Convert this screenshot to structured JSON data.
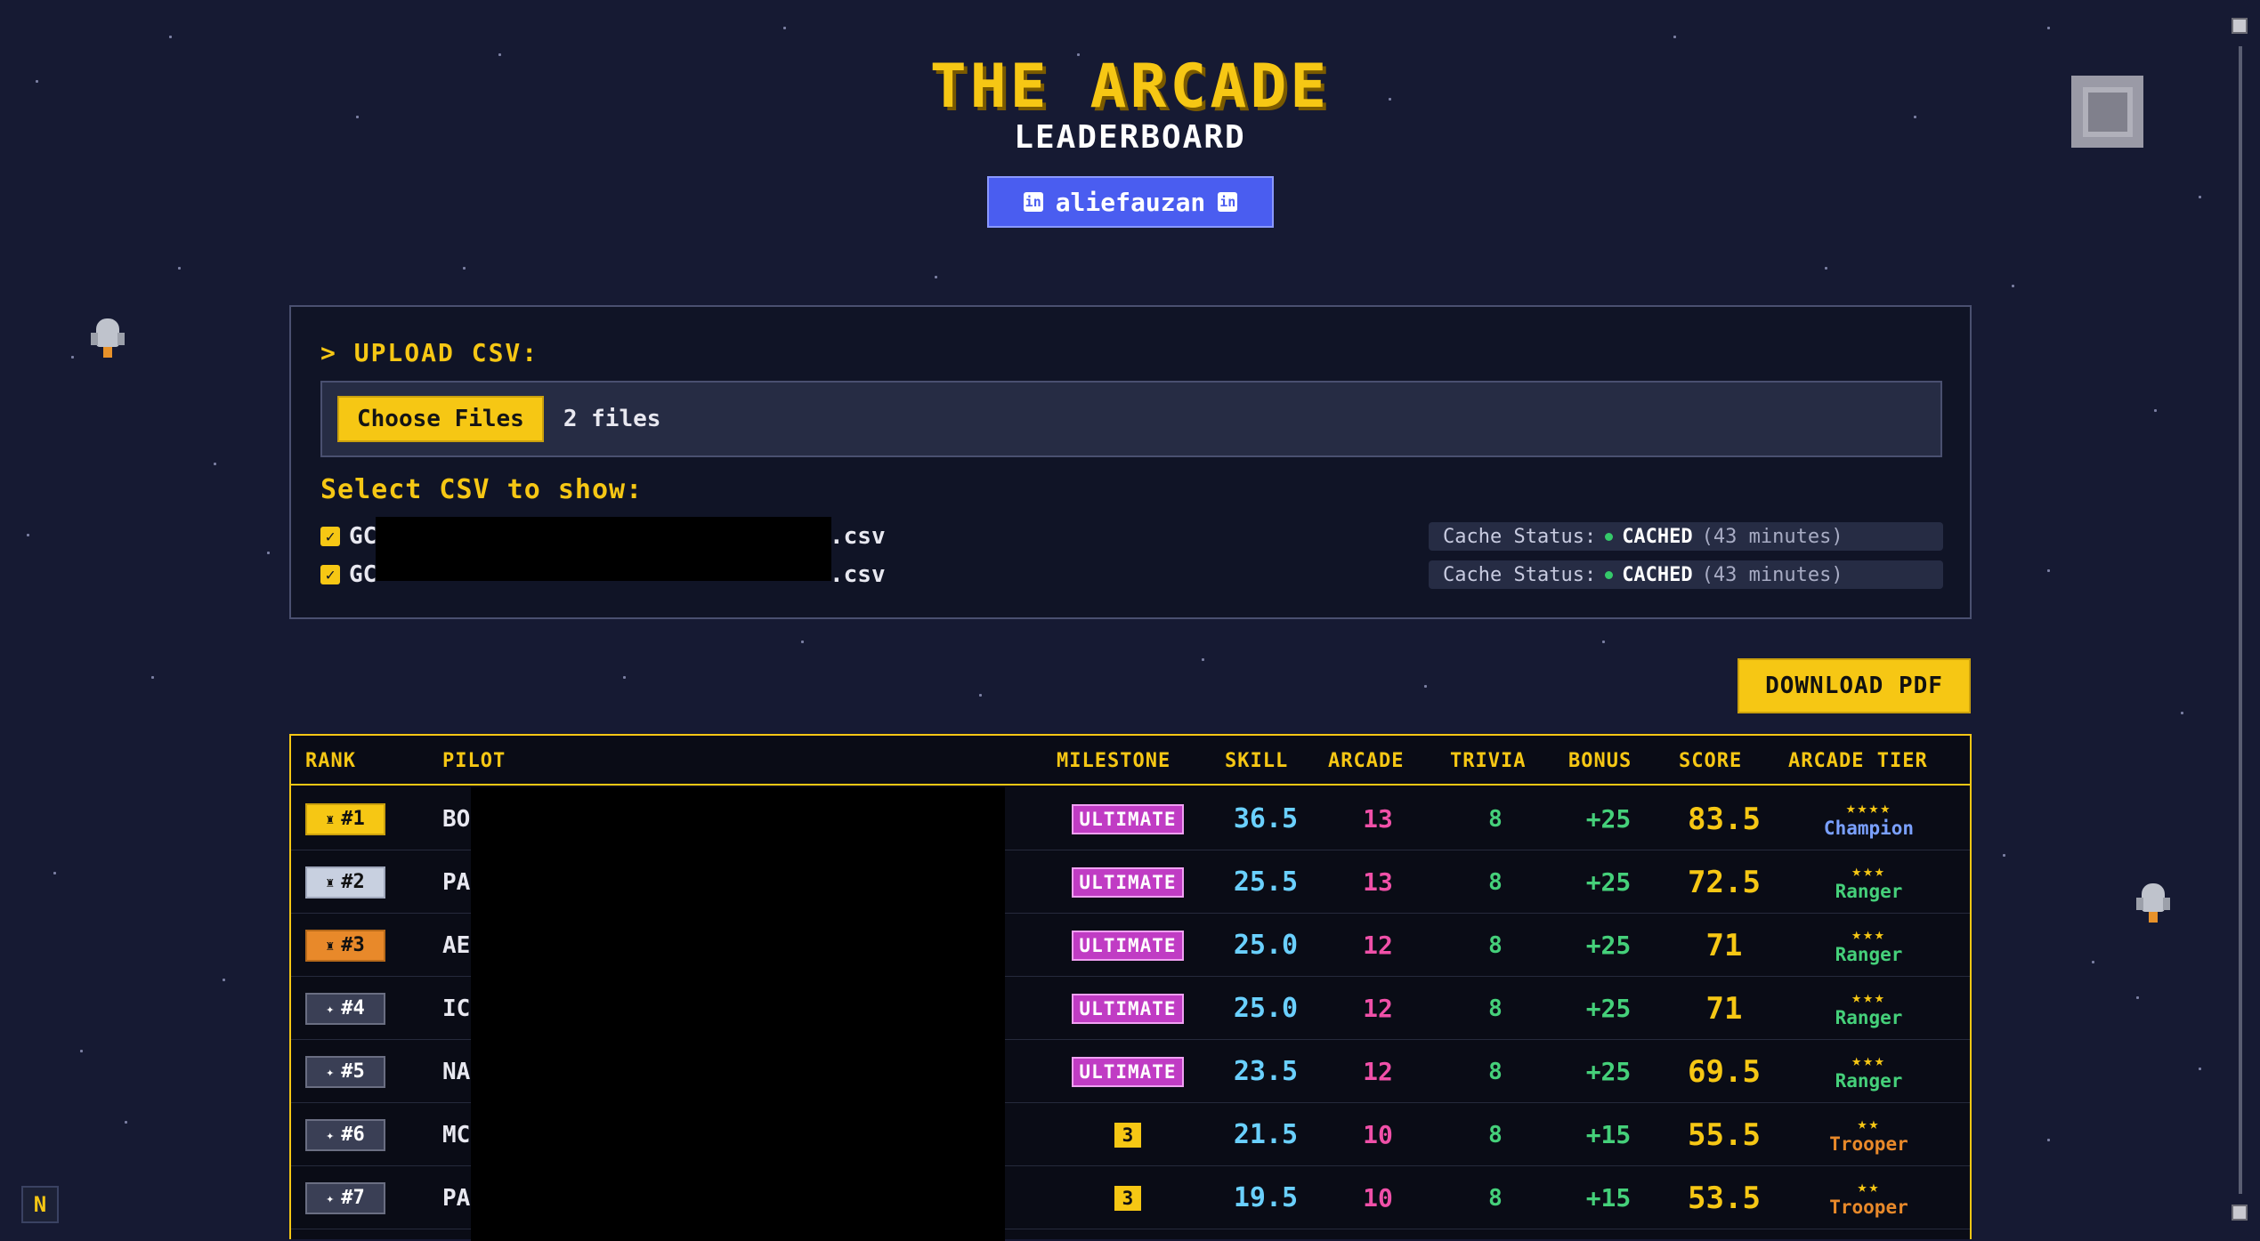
{
  "header": {
    "title": "THE ARCADE",
    "subtitle": "LEADERBOARD",
    "user_button": "aliefauzan",
    "linkedin_icon": "in"
  },
  "upload": {
    "label": "> UPLOAD CSV:",
    "choose_button": "Choose Files",
    "file_count": "2 files",
    "select_label": "Select CSV to show:",
    "files": [
      {
        "name_prefix": "GC",
        "extension": ".csv",
        "checked": true,
        "cache_label": "Cache Status:",
        "cache_status": "CACHED",
        "cache_age": "(43 minutes)"
      },
      {
        "name_prefix": "GC",
        "extension": ".csv",
        "checked": true,
        "cache_label": "Cache Status:",
        "cache_status": "CACHED",
        "cache_age": "(43 minutes)"
      }
    ]
  },
  "download_pdf": "DOWNLOAD PDF",
  "table": {
    "columns": [
      "RANK",
      "PILOT",
      "MILESTONE",
      "SKILL",
      "ARCADE",
      "TRIVIA",
      "BONUS",
      "SCORE",
      "ARCADE TIER"
    ],
    "rows": [
      {
        "rank": "#1",
        "icon": "trophy-icon",
        "pilot": "BO",
        "milestone": "ULTIMATE",
        "skill": "36.5",
        "arcade": "13",
        "trivia": "8",
        "bonus": "+25",
        "score": "83.5",
        "stars": "★★★★",
        "tier": "Champion"
      },
      {
        "rank": "#2",
        "icon": "trophy-icon",
        "pilot": "PA",
        "milestone": "ULTIMATE",
        "skill": "25.5",
        "arcade": "13",
        "trivia": "8",
        "bonus": "+25",
        "score": "72.5",
        "stars": "★★★",
        "tier": "Ranger"
      },
      {
        "rank": "#3",
        "icon": "trophy-icon",
        "pilot": "AE",
        "milestone": "ULTIMATE",
        "skill": "25.0",
        "arcade": "12",
        "trivia": "8",
        "bonus": "+25",
        "score": "71",
        "stars": "★★★",
        "tier": "Ranger"
      },
      {
        "rank": "#4",
        "icon": "sparkle-icon",
        "pilot": "IC",
        "milestone": "ULTIMATE",
        "skill": "25.0",
        "arcade": "12",
        "trivia": "8",
        "bonus": "+25",
        "score": "71",
        "stars": "★★★",
        "tier": "Ranger"
      },
      {
        "rank": "#5",
        "icon": "sparkle-icon",
        "pilot": "NA",
        "milestone": "ULTIMATE",
        "skill": "23.5",
        "arcade": "12",
        "trivia": "8",
        "bonus": "+25",
        "score": "69.5",
        "stars": "★★★",
        "tier": "Ranger"
      },
      {
        "rank": "#6",
        "icon": "sparkle-icon",
        "pilot": "MC",
        "milestone": "3",
        "skill": "21.5",
        "arcade": "10",
        "trivia": "8",
        "bonus": "+15",
        "score": "55.5",
        "stars": "★★",
        "tier": "Trooper"
      },
      {
        "rank": "#7",
        "icon": "sparkle-icon",
        "pilot": "PA",
        "milestone": "3",
        "skill": "19.5",
        "arcade": "10",
        "trivia": "8",
        "bonus": "+15",
        "score": "53.5",
        "stars": "★★",
        "tier": "Trooper"
      }
    ]
  },
  "corner_badge": "N",
  "colors": {
    "accent": "#f6c714",
    "background": "#161a33",
    "link": "#4a5df0"
  }
}
